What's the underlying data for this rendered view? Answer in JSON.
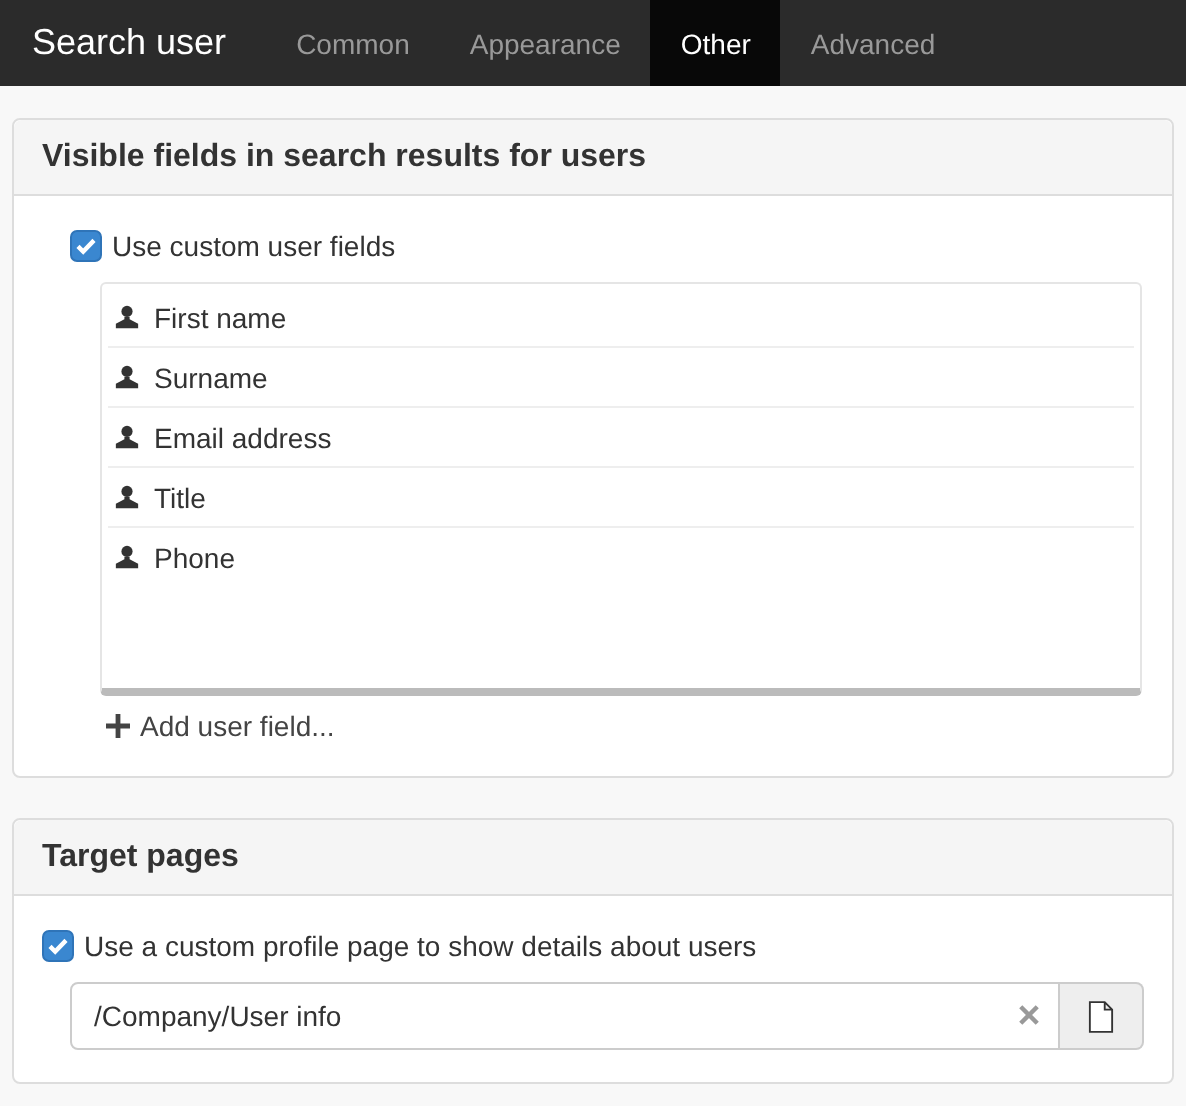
{
  "header": {
    "title": "Search user",
    "tabs": [
      {
        "label": "Common",
        "selected": false
      },
      {
        "label": "Appearance",
        "selected": false
      },
      {
        "label": "Other",
        "selected": true
      },
      {
        "label": "Advanced",
        "selected": false
      }
    ]
  },
  "visible_fields": {
    "title": "Visible fields in search results for users",
    "custom_fields": {
      "label": "Use custom user fields",
      "checked": true
    },
    "fields": [
      "First name",
      "Surname",
      "Email address",
      "Title",
      "Phone"
    ],
    "add_link": "Add user field..."
  },
  "target_pages": {
    "title": "Target pages",
    "custom_profile": {
      "label": "Use a custom profile page to show details about users",
      "checked": true
    },
    "page_path": {
      "value": "/Company/User info"
    }
  }
}
